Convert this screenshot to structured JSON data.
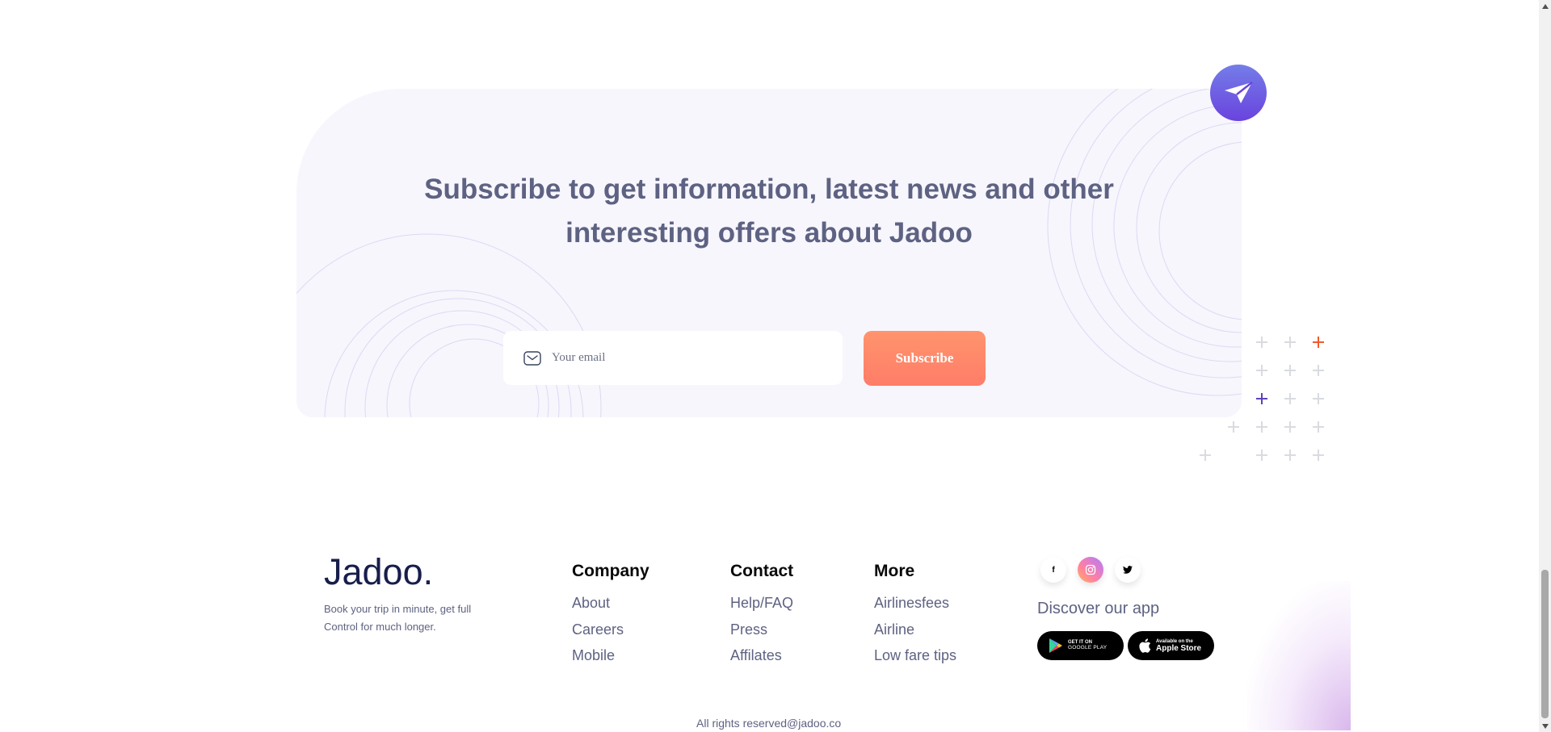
{
  "subscribe": {
    "title": "Subscribe to get information, latest news and other interesting offers about Jadoo",
    "email_placeholder": "Your email",
    "button_label": "Subscribe"
  },
  "footer": {
    "brand": "Jadoo.",
    "tagline": "Book your trip in minute, get full Control for much longer.",
    "columns": [
      {
        "heading": "Company",
        "links": [
          "About",
          "Careers",
          "Mobile"
        ]
      },
      {
        "heading": "Contact",
        "links": [
          "Help/FAQ",
          "Press",
          "Affilates"
        ]
      },
      {
        "heading": "More",
        "links": [
          "Airlinesfees",
          "Airline",
          "Low fare tips"
        ]
      }
    ],
    "socials": [
      {
        "label": "f",
        "icon": "facebook-icon"
      },
      {
        "label": "",
        "icon": "instagram-icon"
      },
      {
        "label": "",
        "icon": "twitter-icon"
      }
    ],
    "discover": "Discover our app",
    "stores": {
      "google": {
        "line1": "GET IT ON",
        "line2": "GOOGLE PLAY"
      },
      "apple": {
        "line1": "Available on the",
        "line2": "Apple Store"
      }
    },
    "copyright": "All rights reserved@jadoo.co"
  },
  "colors": {
    "accent_orange": "#ff7d68",
    "accent_purple": "#6a43de",
    "heading_gray": "#5e6282",
    "brand_navy": "#181e4b"
  }
}
